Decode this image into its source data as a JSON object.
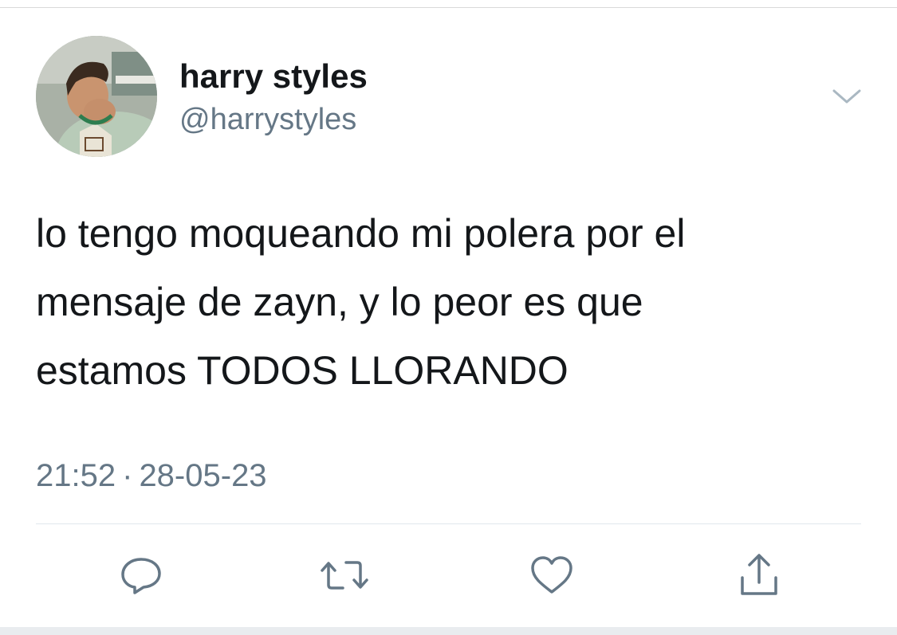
{
  "user": {
    "display_name": "harry styles",
    "handle": "@harrystyles",
    "avatar_icon": "profile-photo"
  },
  "tweet": {
    "lines": [
      "lo tengo moqueando mi polera por el",
      "mensaje de zayn, y lo peor es que",
      "estamos TODOS LLORANDO"
    ],
    "time": "21:52",
    "separator": "·",
    "date": "28-05-23"
  },
  "actions": [
    {
      "icon": "reply-icon"
    },
    {
      "icon": "retweet-icon"
    },
    {
      "icon": "like-icon"
    },
    {
      "icon": "share-icon"
    }
  ],
  "colors": {
    "text": "#14171a",
    "secondary": "#657786",
    "icon": "#657786"
  }
}
